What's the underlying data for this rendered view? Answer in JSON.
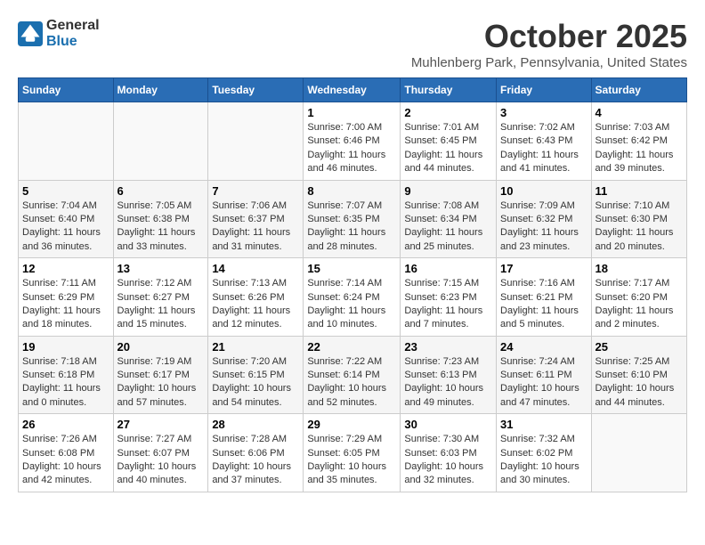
{
  "logo": {
    "text_general": "General",
    "text_blue": "Blue"
  },
  "title": "October 2025",
  "subtitle": "Muhlenberg Park, Pennsylvania, United States",
  "days_of_week": [
    "Sunday",
    "Monday",
    "Tuesday",
    "Wednesday",
    "Thursday",
    "Friday",
    "Saturday"
  ],
  "weeks": [
    [
      {
        "day": "",
        "detail": ""
      },
      {
        "day": "",
        "detail": ""
      },
      {
        "day": "",
        "detail": ""
      },
      {
        "day": "1",
        "detail": "Sunrise: 7:00 AM\nSunset: 6:46 PM\nDaylight: 11 hours\nand 46 minutes."
      },
      {
        "day": "2",
        "detail": "Sunrise: 7:01 AM\nSunset: 6:45 PM\nDaylight: 11 hours\nand 44 minutes."
      },
      {
        "day": "3",
        "detail": "Sunrise: 7:02 AM\nSunset: 6:43 PM\nDaylight: 11 hours\nand 41 minutes."
      },
      {
        "day": "4",
        "detail": "Sunrise: 7:03 AM\nSunset: 6:42 PM\nDaylight: 11 hours\nand 39 minutes."
      }
    ],
    [
      {
        "day": "5",
        "detail": "Sunrise: 7:04 AM\nSunset: 6:40 PM\nDaylight: 11 hours\nand 36 minutes."
      },
      {
        "day": "6",
        "detail": "Sunrise: 7:05 AM\nSunset: 6:38 PM\nDaylight: 11 hours\nand 33 minutes."
      },
      {
        "day": "7",
        "detail": "Sunrise: 7:06 AM\nSunset: 6:37 PM\nDaylight: 11 hours\nand 31 minutes."
      },
      {
        "day": "8",
        "detail": "Sunrise: 7:07 AM\nSunset: 6:35 PM\nDaylight: 11 hours\nand 28 minutes."
      },
      {
        "day": "9",
        "detail": "Sunrise: 7:08 AM\nSunset: 6:34 PM\nDaylight: 11 hours\nand 25 minutes."
      },
      {
        "day": "10",
        "detail": "Sunrise: 7:09 AM\nSunset: 6:32 PM\nDaylight: 11 hours\nand 23 minutes."
      },
      {
        "day": "11",
        "detail": "Sunrise: 7:10 AM\nSunset: 6:30 PM\nDaylight: 11 hours\nand 20 minutes."
      }
    ],
    [
      {
        "day": "12",
        "detail": "Sunrise: 7:11 AM\nSunset: 6:29 PM\nDaylight: 11 hours\nand 18 minutes."
      },
      {
        "day": "13",
        "detail": "Sunrise: 7:12 AM\nSunset: 6:27 PM\nDaylight: 11 hours\nand 15 minutes."
      },
      {
        "day": "14",
        "detail": "Sunrise: 7:13 AM\nSunset: 6:26 PM\nDaylight: 11 hours\nand 12 minutes."
      },
      {
        "day": "15",
        "detail": "Sunrise: 7:14 AM\nSunset: 6:24 PM\nDaylight: 11 hours\nand 10 minutes."
      },
      {
        "day": "16",
        "detail": "Sunrise: 7:15 AM\nSunset: 6:23 PM\nDaylight: 11 hours\nand 7 minutes."
      },
      {
        "day": "17",
        "detail": "Sunrise: 7:16 AM\nSunset: 6:21 PM\nDaylight: 11 hours\nand 5 minutes."
      },
      {
        "day": "18",
        "detail": "Sunrise: 7:17 AM\nSunset: 6:20 PM\nDaylight: 11 hours\nand 2 minutes."
      }
    ],
    [
      {
        "day": "19",
        "detail": "Sunrise: 7:18 AM\nSunset: 6:18 PM\nDaylight: 11 hours\nand 0 minutes."
      },
      {
        "day": "20",
        "detail": "Sunrise: 7:19 AM\nSunset: 6:17 PM\nDaylight: 10 hours\nand 57 minutes."
      },
      {
        "day": "21",
        "detail": "Sunrise: 7:20 AM\nSunset: 6:15 PM\nDaylight: 10 hours\nand 54 minutes."
      },
      {
        "day": "22",
        "detail": "Sunrise: 7:22 AM\nSunset: 6:14 PM\nDaylight: 10 hours\nand 52 minutes."
      },
      {
        "day": "23",
        "detail": "Sunrise: 7:23 AM\nSunset: 6:13 PM\nDaylight: 10 hours\nand 49 minutes."
      },
      {
        "day": "24",
        "detail": "Sunrise: 7:24 AM\nSunset: 6:11 PM\nDaylight: 10 hours\nand 47 minutes."
      },
      {
        "day": "25",
        "detail": "Sunrise: 7:25 AM\nSunset: 6:10 PM\nDaylight: 10 hours\nand 44 minutes."
      }
    ],
    [
      {
        "day": "26",
        "detail": "Sunrise: 7:26 AM\nSunset: 6:08 PM\nDaylight: 10 hours\nand 42 minutes."
      },
      {
        "day": "27",
        "detail": "Sunrise: 7:27 AM\nSunset: 6:07 PM\nDaylight: 10 hours\nand 40 minutes."
      },
      {
        "day": "28",
        "detail": "Sunrise: 7:28 AM\nSunset: 6:06 PM\nDaylight: 10 hours\nand 37 minutes."
      },
      {
        "day": "29",
        "detail": "Sunrise: 7:29 AM\nSunset: 6:05 PM\nDaylight: 10 hours\nand 35 minutes."
      },
      {
        "day": "30",
        "detail": "Sunrise: 7:30 AM\nSunset: 6:03 PM\nDaylight: 10 hours\nand 32 minutes."
      },
      {
        "day": "31",
        "detail": "Sunrise: 7:32 AM\nSunset: 6:02 PM\nDaylight: 10 hours\nand 30 minutes."
      },
      {
        "day": "",
        "detail": ""
      }
    ]
  ]
}
